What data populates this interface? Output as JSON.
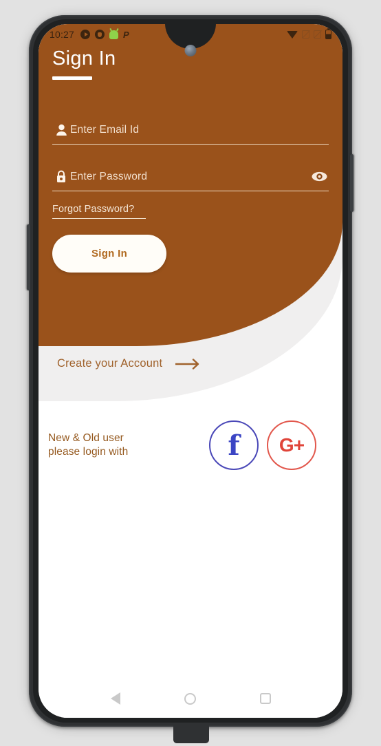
{
  "statusbar": {
    "time": "10:27",
    "left_icons": [
      "play-badge-icon",
      "shield-badge-icon",
      "android-icon",
      "p-app-icon"
    ],
    "right_icons": [
      "wifi-icon",
      "sim1-off-icon",
      "sim2-off-icon",
      "battery-icon"
    ],
    "p_label": "P"
  },
  "screen": {
    "title": "Sign In",
    "brand_color": "#9a521b",
    "band_color": "#f0efef"
  },
  "form": {
    "email": {
      "placeholder": "Enter Email Id",
      "icon": "person-icon",
      "value": ""
    },
    "password": {
      "placeholder": "Enter Password",
      "icon": "lock-icon",
      "toggle_icon": "eye-icon",
      "value": ""
    },
    "forgot_label": "Forgot Password?",
    "submit_label": "Sign In"
  },
  "create_account": {
    "label": "Create your Account",
    "icon": "arrow-right-icon"
  },
  "social": {
    "prompt_line1": "New & Old user",
    "prompt_line2": "please login with",
    "facebook": {
      "glyph": "f",
      "color": "#3b45c4"
    },
    "google": {
      "glyph": "G+",
      "color": "#e0453a"
    }
  },
  "navbar": {
    "back": "back-icon",
    "home": "home-icon",
    "recents": "recents-icon"
  }
}
